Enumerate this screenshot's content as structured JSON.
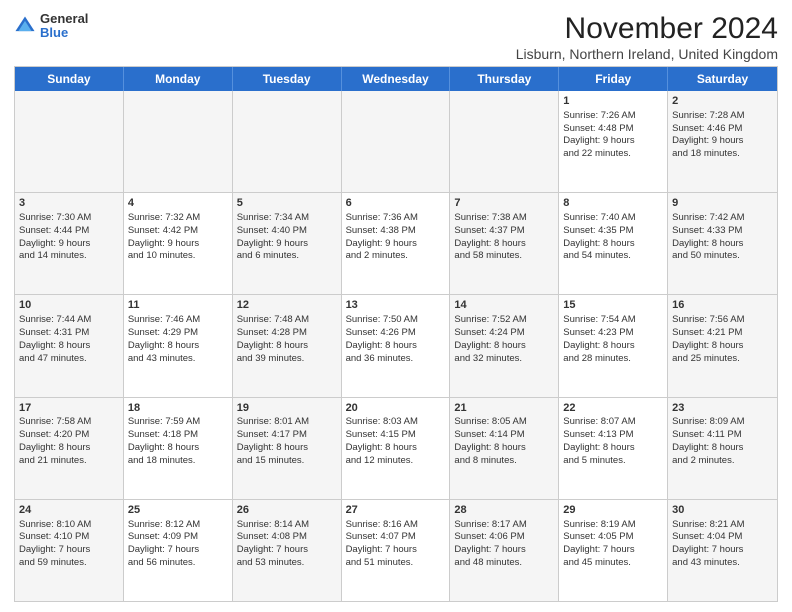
{
  "logo": {
    "general": "General",
    "blue": "Blue"
  },
  "title": "November 2024",
  "location": "Lisburn, Northern Ireland, United Kingdom",
  "days_of_week": [
    "Sunday",
    "Monday",
    "Tuesday",
    "Wednesday",
    "Thursday",
    "Friday",
    "Saturday"
  ],
  "weeks": [
    [
      {
        "day": "",
        "text": ""
      },
      {
        "day": "",
        "text": ""
      },
      {
        "day": "",
        "text": ""
      },
      {
        "day": "",
        "text": ""
      },
      {
        "day": "",
        "text": ""
      },
      {
        "day": "1",
        "text": "Sunrise: 7:26 AM\nSunset: 4:48 PM\nDaylight: 9 hours\nand 22 minutes."
      },
      {
        "day": "2",
        "text": "Sunrise: 7:28 AM\nSunset: 4:46 PM\nDaylight: 9 hours\nand 18 minutes."
      }
    ],
    [
      {
        "day": "3",
        "text": "Sunrise: 7:30 AM\nSunset: 4:44 PM\nDaylight: 9 hours\nand 14 minutes."
      },
      {
        "day": "4",
        "text": "Sunrise: 7:32 AM\nSunset: 4:42 PM\nDaylight: 9 hours\nand 10 minutes."
      },
      {
        "day": "5",
        "text": "Sunrise: 7:34 AM\nSunset: 4:40 PM\nDaylight: 9 hours\nand 6 minutes."
      },
      {
        "day": "6",
        "text": "Sunrise: 7:36 AM\nSunset: 4:38 PM\nDaylight: 9 hours\nand 2 minutes."
      },
      {
        "day": "7",
        "text": "Sunrise: 7:38 AM\nSunset: 4:37 PM\nDaylight: 8 hours\nand 58 minutes."
      },
      {
        "day": "8",
        "text": "Sunrise: 7:40 AM\nSunset: 4:35 PM\nDaylight: 8 hours\nand 54 minutes."
      },
      {
        "day": "9",
        "text": "Sunrise: 7:42 AM\nSunset: 4:33 PM\nDaylight: 8 hours\nand 50 minutes."
      }
    ],
    [
      {
        "day": "10",
        "text": "Sunrise: 7:44 AM\nSunset: 4:31 PM\nDaylight: 8 hours\nand 47 minutes."
      },
      {
        "day": "11",
        "text": "Sunrise: 7:46 AM\nSunset: 4:29 PM\nDaylight: 8 hours\nand 43 minutes."
      },
      {
        "day": "12",
        "text": "Sunrise: 7:48 AM\nSunset: 4:28 PM\nDaylight: 8 hours\nand 39 minutes."
      },
      {
        "day": "13",
        "text": "Sunrise: 7:50 AM\nSunset: 4:26 PM\nDaylight: 8 hours\nand 36 minutes."
      },
      {
        "day": "14",
        "text": "Sunrise: 7:52 AM\nSunset: 4:24 PM\nDaylight: 8 hours\nand 32 minutes."
      },
      {
        "day": "15",
        "text": "Sunrise: 7:54 AM\nSunset: 4:23 PM\nDaylight: 8 hours\nand 28 minutes."
      },
      {
        "day": "16",
        "text": "Sunrise: 7:56 AM\nSunset: 4:21 PM\nDaylight: 8 hours\nand 25 minutes."
      }
    ],
    [
      {
        "day": "17",
        "text": "Sunrise: 7:58 AM\nSunset: 4:20 PM\nDaylight: 8 hours\nand 21 minutes."
      },
      {
        "day": "18",
        "text": "Sunrise: 7:59 AM\nSunset: 4:18 PM\nDaylight: 8 hours\nand 18 minutes."
      },
      {
        "day": "19",
        "text": "Sunrise: 8:01 AM\nSunset: 4:17 PM\nDaylight: 8 hours\nand 15 minutes."
      },
      {
        "day": "20",
        "text": "Sunrise: 8:03 AM\nSunset: 4:15 PM\nDaylight: 8 hours\nand 12 minutes."
      },
      {
        "day": "21",
        "text": "Sunrise: 8:05 AM\nSunset: 4:14 PM\nDaylight: 8 hours\nand 8 minutes."
      },
      {
        "day": "22",
        "text": "Sunrise: 8:07 AM\nSunset: 4:13 PM\nDaylight: 8 hours\nand 5 minutes."
      },
      {
        "day": "23",
        "text": "Sunrise: 8:09 AM\nSunset: 4:11 PM\nDaylight: 8 hours\nand 2 minutes."
      }
    ],
    [
      {
        "day": "24",
        "text": "Sunrise: 8:10 AM\nSunset: 4:10 PM\nDaylight: 7 hours\nand 59 minutes."
      },
      {
        "day": "25",
        "text": "Sunrise: 8:12 AM\nSunset: 4:09 PM\nDaylight: 7 hours\nand 56 minutes."
      },
      {
        "day": "26",
        "text": "Sunrise: 8:14 AM\nSunset: 4:08 PM\nDaylight: 7 hours\nand 53 minutes."
      },
      {
        "day": "27",
        "text": "Sunrise: 8:16 AM\nSunset: 4:07 PM\nDaylight: 7 hours\nand 51 minutes."
      },
      {
        "day": "28",
        "text": "Sunrise: 8:17 AM\nSunset: 4:06 PM\nDaylight: 7 hours\nand 48 minutes."
      },
      {
        "day": "29",
        "text": "Sunrise: 8:19 AM\nSunset: 4:05 PM\nDaylight: 7 hours\nand 45 minutes."
      },
      {
        "day": "30",
        "text": "Sunrise: 8:21 AM\nSunset: 4:04 PM\nDaylight: 7 hours\nand 43 minutes."
      }
    ]
  ]
}
